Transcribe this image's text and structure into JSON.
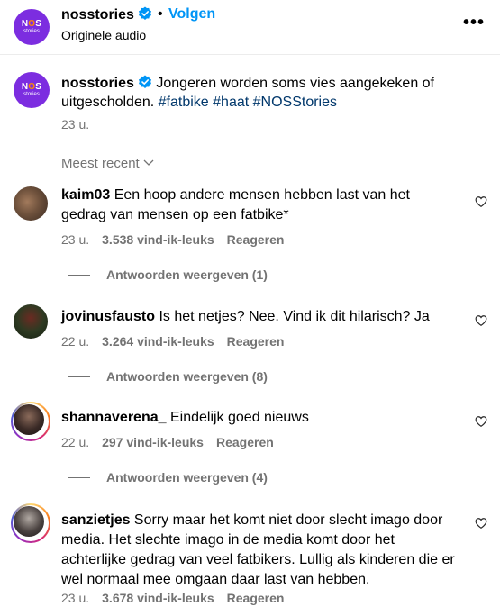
{
  "header": {
    "username": "nosstories",
    "dot": "•",
    "follow_label": "Volgen",
    "audio_label": "Originele audio",
    "more_label": "•••"
  },
  "logo": {
    "line1_n": "N",
    "line1_o": "O",
    "line1_s": "S",
    "line2": "stories"
  },
  "caption": {
    "username": "nosstories",
    "text": " Jongeren worden soms vies aangekeken of uitgescholden. ",
    "hashtags": [
      "#fatbike",
      "#haat",
      "#NOSStories"
    ],
    "time": "23 u."
  },
  "sort_label": "Meest recent",
  "comments": [
    {
      "username": "kaim03",
      "text": " Een hoop andere mensen hebben last van het gedrag van mensen op een fatbike*",
      "time": "23 u.",
      "likes": "3.538 vind-ik-leuks",
      "reply_label": "Reageren",
      "view_replies": "Antwoorden weergeven (1)"
    },
    {
      "username": "jovinusfausto",
      "text": " Is het netjes? Nee. Vind ik dit hilarisch? Ja",
      "time": "22 u.",
      "likes": "3.264 vind-ik-leuks",
      "reply_label": "Reageren",
      "view_replies": "Antwoorden weergeven (8)"
    },
    {
      "username": "shannaverena_",
      "text": " Eindelijk goed nieuws",
      "time": "22 u.",
      "likes": "297 vind-ik-leuks",
      "reply_label": "Reageren",
      "view_replies": "Antwoorden weergeven (4)"
    },
    {
      "username": "sanzietjes",
      "text": " Sorry maar het komt niet door slecht imago door media. Het slechte imago in de media komt door het achterlijke gedrag van veel fatbikers. Lullig als kinderen die er wel normaal mee omgaan daar last van hebben.",
      "time": "23 u.",
      "likes": "3.678 vind-ik-leuks",
      "reply_label": "Reageren"
    }
  ],
  "colors": {
    "link_blue": "#0095f6",
    "hashtag": "#00376b",
    "muted": "#737373",
    "logo_bg": "#7c2de0",
    "logo_accent": "#ff8a00",
    "verified": "#0095f6"
  }
}
